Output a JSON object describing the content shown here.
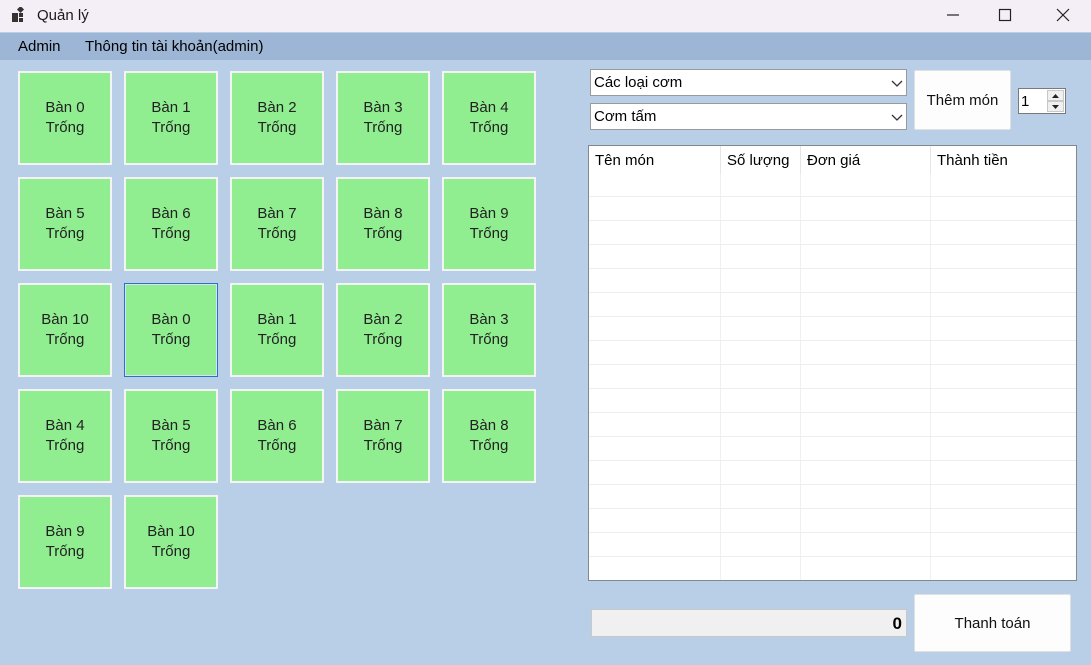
{
  "window": {
    "title": "Quản lý",
    "icon": "app-window-icon",
    "controls": [
      "minimize-icon",
      "maximize-icon",
      "close-icon"
    ]
  },
  "menu": {
    "admin": "Admin",
    "account_info": "Thông tin tài khoản(admin)"
  },
  "tables": [
    {
      "name": "Bàn 0",
      "status": "Trống"
    },
    {
      "name": "Bàn 1",
      "status": "Trống"
    },
    {
      "name": "Bàn 2",
      "status": "Trống"
    },
    {
      "name": "Bàn 3",
      "status": "Trống"
    },
    {
      "name": "Bàn 4",
      "status": "Trống"
    },
    {
      "name": "Bàn 5",
      "status": "Trống"
    },
    {
      "name": "Bàn 6",
      "status": "Trống"
    },
    {
      "name": "Bàn 7",
      "status": "Trống"
    },
    {
      "name": "Bàn 8",
      "status": "Trống"
    },
    {
      "name": "Bàn 9",
      "status": "Trống"
    },
    {
      "name": "Bàn 10",
      "status": "Trống"
    },
    {
      "name": "Bàn 0",
      "status": "Trống"
    },
    {
      "name": "Bàn 1",
      "status": "Trống"
    },
    {
      "name": "Bàn 2",
      "status": "Trống"
    },
    {
      "name": "Bàn 3",
      "status": "Trống"
    },
    {
      "name": "Bàn 4",
      "status": "Trống"
    },
    {
      "name": "Bàn 5",
      "status": "Trống"
    },
    {
      "name": "Bàn 6",
      "status": "Trống"
    },
    {
      "name": "Bàn 7",
      "status": "Trống"
    },
    {
      "name": "Bàn 8",
      "status": "Trống"
    },
    {
      "name": "Bàn 9",
      "status": "Trống"
    },
    {
      "name": "Bàn 10",
      "status": "Trống"
    }
  ],
  "order": {
    "category": "Các loại cơm",
    "food": "Cơm tấm",
    "add_button": "Thêm món",
    "quantity": "1",
    "columns": [
      "Tên món",
      "Số lượng",
      "Đơn giá",
      "Thành tiền"
    ],
    "total": "0",
    "checkout_button": "Thanh toán"
  },
  "colors": {
    "background": "#b9cfe7",
    "menubar": "#9db6d5",
    "table_empty": "#90ee90",
    "selected_border": "#2f6fc4"
  }
}
